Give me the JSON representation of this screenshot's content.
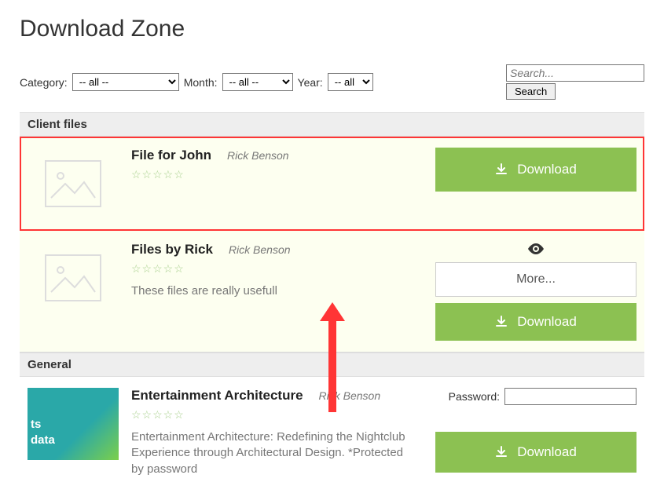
{
  "page_title": "Download Zone",
  "filters": {
    "category_label": "Category:",
    "category_selected": "-- all --",
    "month_label": "Month:",
    "month_selected": "-- all --",
    "year_label": "Year:",
    "year_selected": "-- all --"
  },
  "search": {
    "placeholder": "Search...",
    "button": "Search"
  },
  "sections": {
    "client": "Client files",
    "general": "General"
  },
  "items": [
    {
      "title": "File for John",
      "author": "Rick Benson",
      "download": "Download"
    },
    {
      "title": "Files by Rick",
      "author": "Rick Benson",
      "desc": "These files are really usefull",
      "more": "More...",
      "download": "Download"
    },
    {
      "title": "Entertainment Architecture",
      "author": "Rick Benson",
      "desc": "Entertainment Architecture: Redefining the Nightclub Experience through Architectural Design. *Protected by password",
      "password_label": "Password:",
      "download": "Download",
      "thumb_text1": "ts",
      "thumb_text2": "data"
    }
  ],
  "stars_glyph": "☆☆☆☆☆"
}
